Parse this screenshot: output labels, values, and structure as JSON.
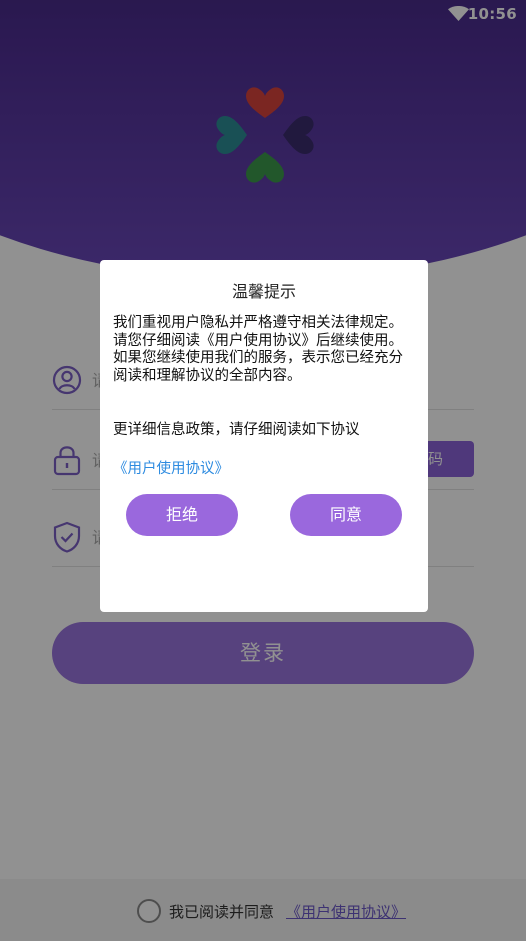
{
  "status_bar": {
    "time": "10:56",
    "wifi_icon": "wifi-icon"
  },
  "logo": {
    "icon": "four-hearts-clover-logo"
  },
  "form": {
    "phone_icon": "user-icon",
    "phone_placeholder": "请",
    "password_icon": "lock-icon",
    "password_placeholder": "请",
    "code_button_label": "证码",
    "code_icon": "shield-check-icon",
    "code_placeholder": "请"
  },
  "login": {
    "label": "登录"
  },
  "agreement": {
    "text": "我已阅读并同意",
    "link": "《用户使用协议》"
  },
  "dialog": {
    "title": "温馨提示",
    "body": "我们重视用户隐私并严格遵守相关法律规定。请您仔细阅读《用户使用协议》后继续使用。如果您继续使用我们的服务，表示您已经充分阅读和理解协议的全部内容。",
    "note": "更详细信息政策，请仔细阅读如下协议",
    "link": "《用户使用协议》",
    "reject_label": "拒绝",
    "agree_label": "同意"
  },
  "colors": {
    "header_dark": "#2b1a59",
    "header_light": "#6a48ba",
    "accent": "#9a68dd",
    "link": "#2d8be0"
  }
}
